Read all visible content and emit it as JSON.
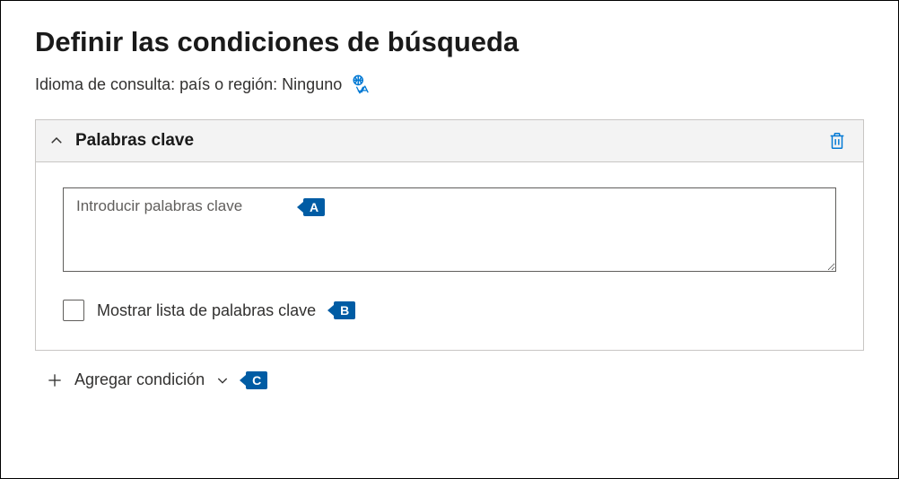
{
  "header": {
    "title": "Definir las condiciones de búsqueda",
    "queryLanguageLabel": "Idioma de consulta: país o región: Ninguno"
  },
  "card": {
    "title": "Palabras clave",
    "keywordsPlaceholder": "Introducir palabras clave",
    "keywordsValue": "",
    "showKeywordListLabel": "Mostrar lista de palabras clave",
    "showKeywordListChecked": false
  },
  "actions": {
    "addConditionLabel": "Agregar condición"
  },
  "markers": {
    "a": "A",
    "b": "B",
    "c": "C"
  }
}
